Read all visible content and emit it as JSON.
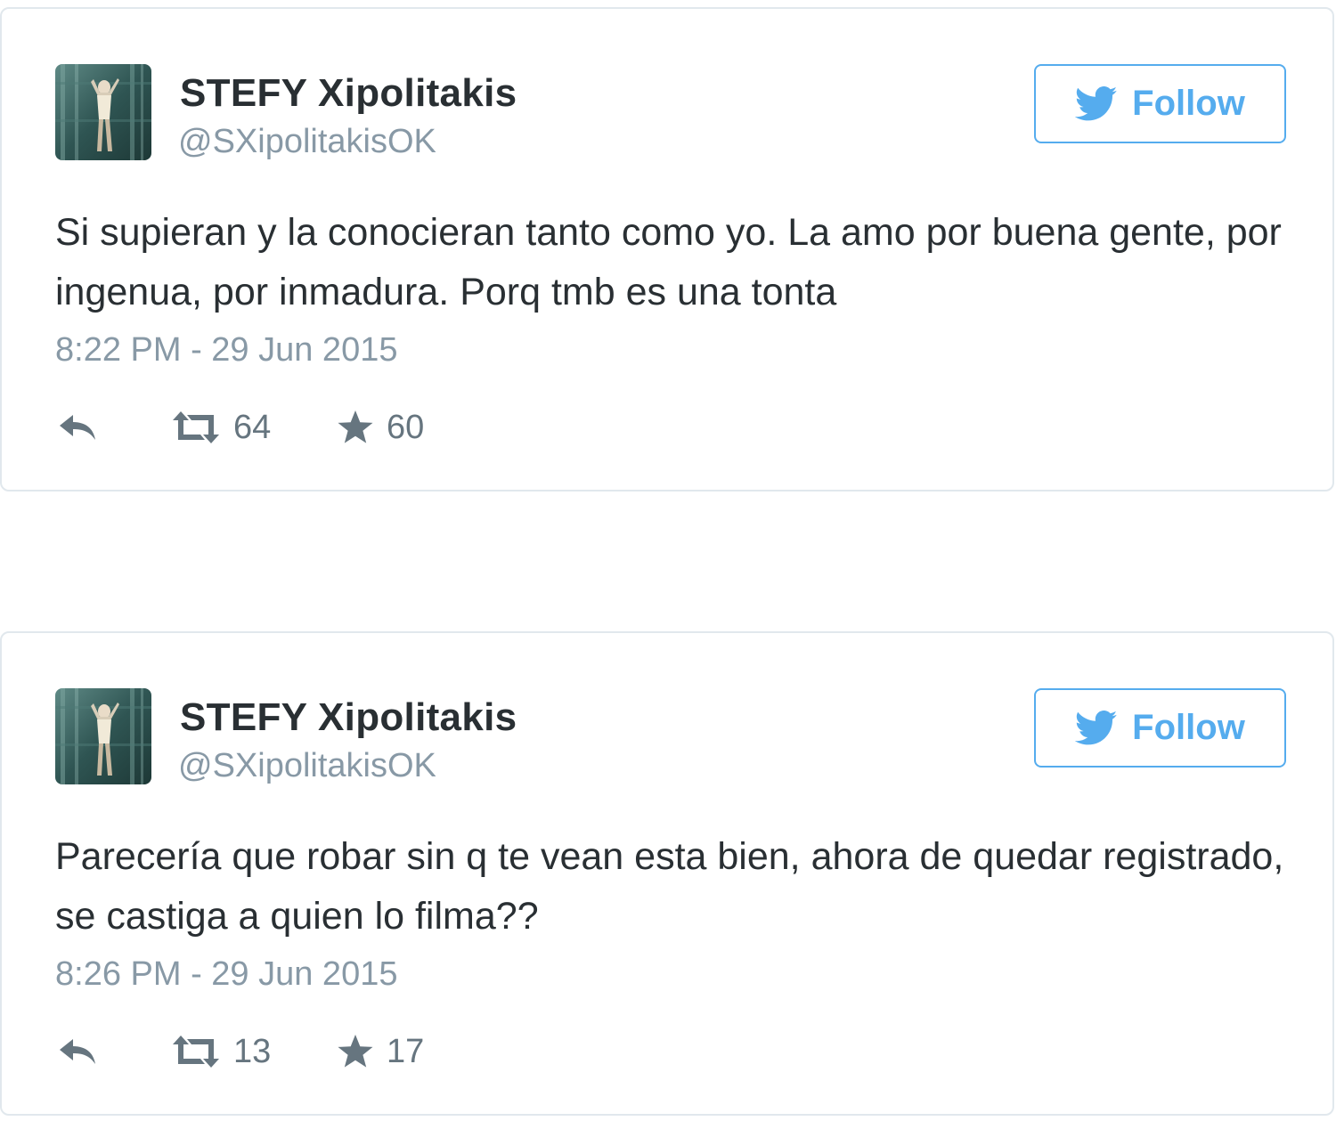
{
  "tweets": [
    {
      "author_name": "STEFY Xipolitakis",
      "author_handle": "@SXipolitakisOK",
      "avatar_icon": "profile-photo",
      "follow_label": "Follow",
      "text": "Si supieran y la conocieran tanto como yo. La amo por buena gente, por ingenua, por inmadura. Porq tmb es una tonta",
      "timestamp": "8:22 PM - 29 Jun 2015",
      "retweet_count": "64",
      "favorite_count": "60"
    },
    {
      "author_name": "STEFY Xipolitakis",
      "author_handle": "@SXipolitakisOK",
      "avatar_icon": "profile-photo",
      "follow_label": "Follow",
      "text": "Parecería que robar sin q te vean esta bien, ahora de quedar registrado, se castiga a quien lo filma??",
      "timestamp": "8:26 PM - 29 Jun 2015",
      "retweet_count": "13",
      "favorite_count": "17"
    }
  ],
  "icons": {
    "brand": "twitter-bird-icon",
    "reply": "reply-icon",
    "retweet": "retweet-icon",
    "favorite": "star-icon"
  },
  "colors": {
    "accent": "#55acee",
    "text": "#292f33",
    "muted": "#8899a6",
    "action": "#66757f",
    "border": "#e1e8ed"
  }
}
